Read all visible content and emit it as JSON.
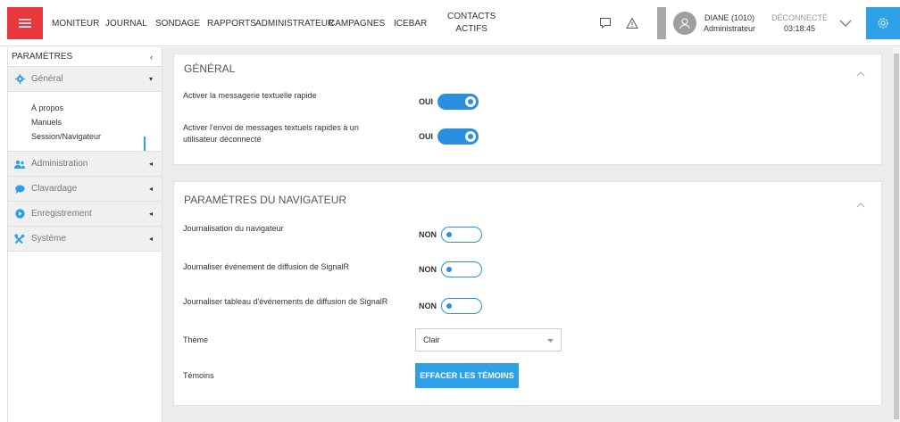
{
  "nav": {
    "items": [
      "MONITEUR",
      "JOURNAL",
      "SONDAGE",
      "RAPPORTS",
      "ADMINISTRATEUR",
      "CAMPAGNES",
      "ICEBAR"
    ],
    "contacts_line1": "CONTACTS",
    "contacts_line2": "ACTIFS"
  },
  "user": {
    "name": "DIANE (1010)",
    "role": "Administrateur",
    "status": "DÉCONNECTÉ",
    "timer": "03:18:45"
  },
  "sidebar": {
    "title": "PARAMÈTRES",
    "groups": [
      {
        "label": "Général",
        "icon": "gear-icon",
        "expanded": true
      },
      {
        "label": "Administration",
        "icon": "users-icon"
      },
      {
        "label": "Clavardage",
        "icon": "chat-icon"
      },
      {
        "label": "Enregistrement",
        "icon": "record-icon"
      },
      {
        "label": "Système",
        "icon": "tools-icon"
      }
    ],
    "sub_items": [
      "À propos",
      "Manuels",
      "Session/Navigateur"
    ]
  },
  "general": {
    "title": "GÉNÉRAL",
    "rows": [
      {
        "label": "Activer la messagerie textuelle rapide",
        "value": "OUI"
      },
      {
        "label_line1": "Activer l'envoi de messages textuels rapides à un",
        "label_line2": "utilisateur déconnecté",
        "value": "OUI"
      }
    ]
  },
  "browser": {
    "title": "PARAMÈTRES DU NAVIGATEUR",
    "rows": [
      {
        "label": "Journalisation du navigateur",
        "value": "NON"
      },
      {
        "label": "Journaliser événement de diffusion de SignalR",
        "value": "NON"
      },
      {
        "label": "Journaliser tableau d'événements de diffusion de SignalR",
        "value": "NON"
      }
    ],
    "theme_label": "Thème",
    "theme_value": "Clair",
    "cookies_label": "Témoins",
    "cookies_button": "EFFACER LES TÉMOINS"
  },
  "colors": {
    "menu_red": "#e8383d",
    "accent_blue": "#2da0e8",
    "toggle_blue": "#2a8fe0"
  }
}
